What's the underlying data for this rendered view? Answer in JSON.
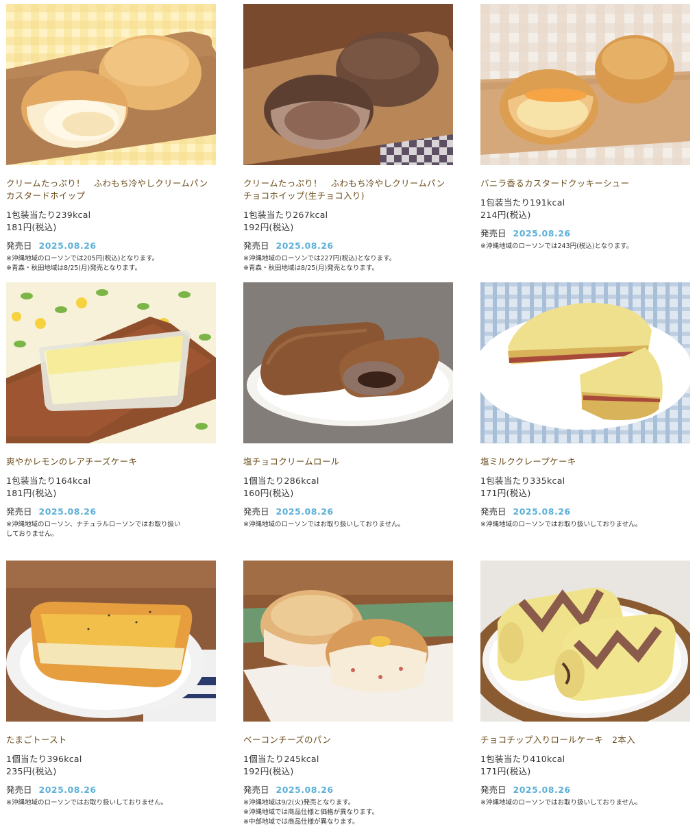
{
  "release_label": "発売日",
  "products": [
    {
      "name": "クリームたっぷり！　ふわもち冷やしクリームパン　カスタードホイップ",
      "kcal": "1包装当たり239kcal",
      "price": "181円(税込)",
      "release_date": "2025.08.26",
      "notes": [
        "※沖縄地域のローソンでは205円(税込)となります。",
        "※青森・秋田地域は8/25(月)発売となります。"
      ],
      "image": "custard-cream-bun-photo"
    },
    {
      "name": "クリームたっぷり！　ふわもち冷やしクリームパン　チョコホイップ(生チョコ入り)",
      "kcal": "1包装当たり267kcal",
      "price": "192円(税込)",
      "release_date": "2025.08.26",
      "notes": [
        "※沖縄地域のローソンでは227円(税込)となります。",
        "※青森・秋田地域は8/25(月)発売となります。"
      ],
      "image": "chocolate-cream-bun-photo"
    },
    {
      "name": "バニラ香るカスタードクッキーシュー",
      "kcal": "1包装当たり191kcal",
      "price": "214円(税込)",
      "release_date": "2025.08.26",
      "notes": [
        "※沖縄地域のローソンでは243円(税込)となります。"
      ],
      "image": "cookie-choux-photo"
    },
    {
      "name": "爽やかレモンのレアチーズケーキ",
      "kcal": "1包装当たり164kcal",
      "price": "181円(税込)",
      "release_date": "2025.08.26",
      "notes": [
        "※沖縄地域のローソン、ナチュラルローソンではお取り扱い",
        "しておりません。"
      ],
      "image": "lemon-cheesecake-photo"
    },
    {
      "name": "塩チョコクリームロール",
      "kcal": "1個当たり286kcal",
      "price": "160円(税込)",
      "release_date": "2025.08.26",
      "notes": [
        "※沖縄地域のローソンではお取り扱いしておりません。"
      ],
      "image": "salt-choco-roll-photo"
    },
    {
      "name": "塩ミルククレープケーキ",
      "kcal": "1包装当たり335kcal",
      "price": "171円(税込)",
      "release_date": "2025.08.26",
      "notes": [
        "※沖縄地域のローソンではお取り扱いしておりません。"
      ],
      "image": "milk-crepe-cake-photo"
    },
    {
      "name": "たまごトースト",
      "kcal": "1個当たり396kcal",
      "price": "235円(税込)",
      "release_date": "2025.08.26",
      "notes": [
        "※沖縄地域のローソンではお取り扱いしておりません。"
      ],
      "image": "egg-toast-photo"
    },
    {
      "name": "ベーコンチーズのパン",
      "kcal": "1個当たり245kcal",
      "price": "192円(税込)",
      "release_date": "2025.08.26",
      "notes": [
        "※沖縄地域は9/2(火)発売となります。",
        "※沖縄地域では商品仕様と価格が異なります。",
        "※中部地域では商品仕様が異なります。"
      ],
      "image": "bacon-cheese-bread-photo"
    },
    {
      "name": "チョコチップ入りロールケーキ　2本入",
      "kcal": "1包装当たり410kcal",
      "price": "171円(税込)",
      "release_date": "2025.08.26",
      "notes": [
        "※沖縄地域のローソンではお取り扱いしておりません。"
      ],
      "image": "choco-chip-roll-cake-photo"
    }
  ],
  "colors": {
    "name_text": "#6a4d1b",
    "date_text": "#5bb0d8",
    "body_text": "#333333"
  }
}
